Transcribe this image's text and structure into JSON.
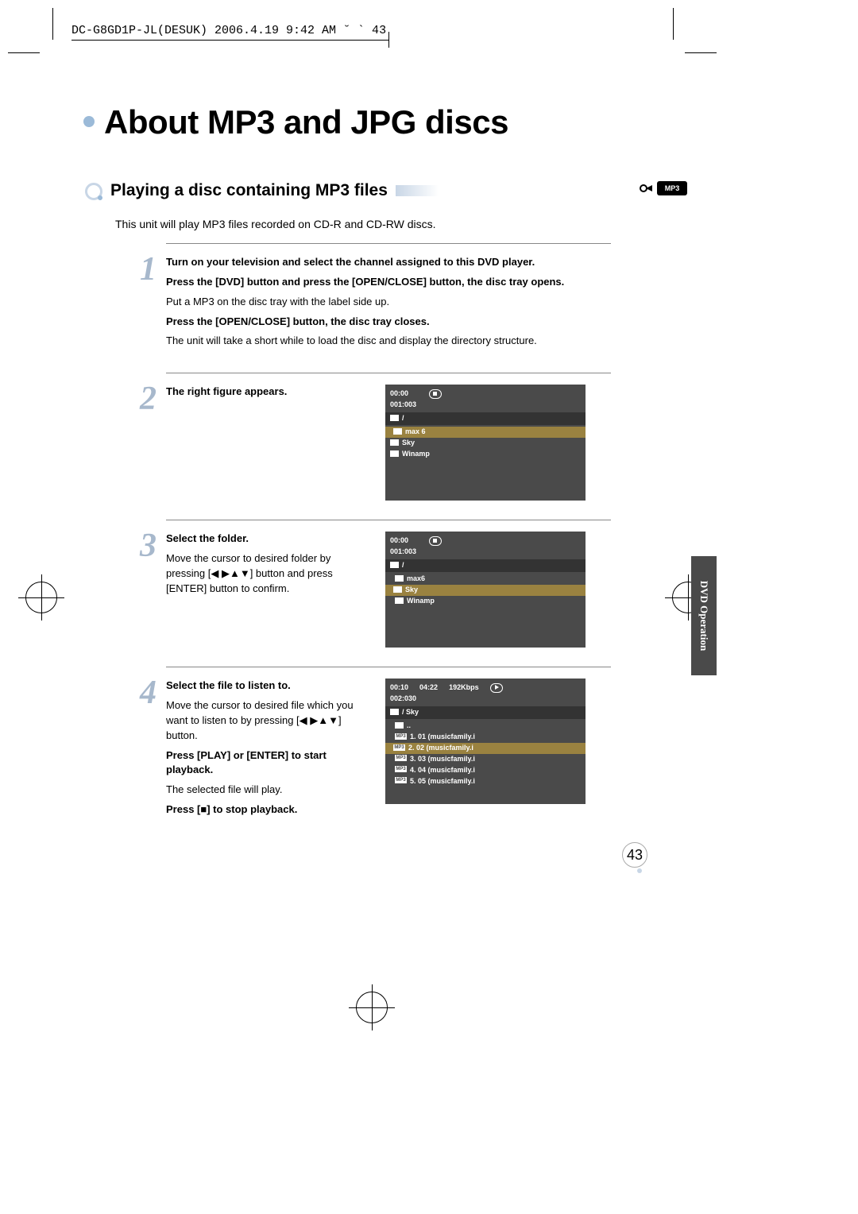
{
  "print_header": "DC-G8GD1P-JL(DESUK)  2006.4.19 9:42 AM  ˘  `  43",
  "title": "About MP3 and JPG discs",
  "subhead": "Playing a disc containing MP3 files",
  "mp3_badge": "MP3",
  "intro": "This unit will play MP3 files recorded on CD-R and CD-RW discs.",
  "side_tab": "DVD Operation",
  "page_num": "43",
  "step1": {
    "l1": "Turn on your television and select the channel assigned to this DVD player.",
    "l2": "Press the [DVD] button and press the [OPEN/CLOSE] button, the disc tray opens.",
    "l3": "Put a MP3 on the disc tray with the label side up.",
    "l4": "Press the [OPEN/CLOSE] button, the disc tray closes.",
    "l5": "The unit will take a short while to load the disc and display the directory structure."
  },
  "step2": {
    "l1": "The right figure appears.",
    "osd": {
      "time": "00:00",
      "counter": "001:003",
      "root": "/",
      "items": [
        "max 6",
        "Sky",
        "Winamp"
      ]
    }
  },
  "step3": {
    "l1": "Select the folder.",
    "l2": "Move the cursor to desired folder by pressing [◀ ▶▲▼] button and press [ENTER] button to confirm.",
    "osd": {
      "time": "00:00",
      "counter": "001:003",
      "root": "/",
      "items": [
        "max6",
        "Sky",
        "Winamp"
      ]
    }
  },
  "step4": {
    "l1": "Select the file to listen to.",
    "l2": "Move the cursor to desired file which you want to listen to by pressing [◀ ▶▲▼] button.",
    "l3": "Press [PLAY] or [ENTER] to start playback.",
    "l4": "The selected file will play.",
    "l5": "Press [■] to stop playback.",
    "osd": {
      "time": "00:10",
      "dur": "04:22",
      "rate": "192Kbps",
      "counter": "002:030",
      "root": "/ Sky",
      "up": "..",
      "items": [
        "1. 01 (musicfamily.i",
        "2. 02 (musicfamily.i",
        "3. 03 (musicfamily.i",
        "4. 04 (musicfamily.i",
        "5. 05 (musicfamily.i"
      ]
    }
  }
}
